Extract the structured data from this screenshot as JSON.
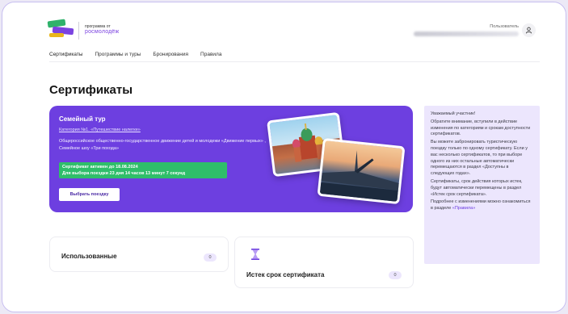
{
  "header": {
    "program_line1": "программа от",
    "program_line2": "росмолодёж",
    "user_label": "Пользователь"
  },
  "tabs": [
    {
      "label": "Сертификаты",
      "active": true
    },
    {
      "label": "Программы и туры",
      "active": false
    },
    {
      "label": "Бронирования",
      "active": false
    },
    {
      "label": "Правила",
      "active": false
    }
  ],
  "page_title": "Сертификаты",
  "hero": {
    "title": "Семейный тур",
    "category": "Категория №1. «Путешествие налегке»",
    "description": "Общероссийское общественно-государственное движение детей и молодежи «Движение первых» , Семейное шоу «Три похода»",
    "status_line1": "Сертификат активен до 18.08.2024",
    "status_line2": "Для выбора поездки 23 дня 14 часов 13 минут 7 секунд",
    "button": "Выбрать поездку"
  },
  "notice": {
    "p1": "Уважаемый участник!",
    "p2": "Обратите внимание, вступили в действие изменения по категориям и срокам доступности сертификатов.",
    "p3": "Вы можете забронировать туристическую поездку только по одному сертификату. Если у вас несколько сертификатов, то при выборе одного из них остальные автоматически перемещаются в раздел «Доступны в следующих годах».",
    "p4": "Сертификаты, срок действия которых истек, будут автоматически перемещены в раздел «Истек срок сертификата».",
    "p5_text": "Подробнее с изменениями можно ознакомиться в разделе ",
    "p5_link": "«Правила»"
  },
  "cards": [
    {
      "label": "Использованные",
      "count": "0"
    },
    {
      "label": "Истек срок сертификата",
      "count": "0"
    }
  ],
  "colors": {
    "accent": "#6d3fe0",
    "success": "#2fbe6a",
    "notice_bg": "#ece6fd"
  }
}
